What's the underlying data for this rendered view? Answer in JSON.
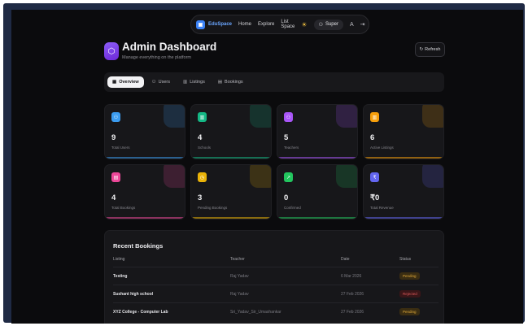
{
  "nav": {
    "brand": "EduSpace",
    "links": [
      "Home",
      "Explore",
      "List Space"
    ],
    "user": "Super"
  },
  "header": {
    "title": "Admin Dashboard",
    "subtitle": "Manage everything on the platform",
    "refresh_label": "Refresh"
  },
  "tabs": [
    {
      "label": "Overview",
      "active": true
    },
    {
      "label": "Users",
      "active": false
    },
    {
      "label": "Listings",
      "active": false
    },
    {
      "label": "Bookings",
      "active": false
    }
  ],
  "stats": [
    {
      "value": "9",
      "label": "Total Users",
      "color": "#3b9cf0",
      "icon": "users-icon"
    },
    {
      "value": "4",
      "label": "Schools",
      "color": "#14b885",
      "icon": "school-icon"
    },
    {
      "value": "5",
      "label": "Teachers",
      "color": "#a855f7",
      "icon": "teacher-icon"
    },
    {
      "value": "6",
      "label": "Active Listings",
      "color": "#f59e0b",
      "icon": "listing-icon"
    },
    {
      "value": "4",
      "label": "Total Bookings",
      "color": "#ec4899",
      "icon": "calendar-icon"
    },
    {
      "value": "3",
      "label": "Pending Bookings",
      "color": "#eab308",
      "icon": "clock-icon"
    },
    {
      "value": "0",
      "label": "Confirmed",
      "color": "#22c55e",
      "icon": "trend-icon"
    },
    {
      "value": "₹0",
      "label": "Total Revenue",
      "color": "#6366f1",
      "icon": "rupee-icon"
    }
  ],
  "bookings": {
    "title": "Recent Bookings",
    "columns": [
      "Listing",
      "Teacher",
      "Date",
      "Status"
    ],
    "rows": [
      {
        "listing": "Testing",
        "teacher": "Raj Yadav",
        "date": "6 Mar 2026",
        "status": "Pending"
      },
      {
        "listing": "Sushant high school",
        "teacher": "Raj Yadav",
        "date": "27 Feb 2026",
        "status": "Rejected"
      },
      {
        "listing": "XYZ College - Computer Lab",
        "teacher": "Sri_Yadav_Sir_Umashankar",
        "date": "27 Feb 2026",
        "status": "Pending"
      }
    ]
  }
}
